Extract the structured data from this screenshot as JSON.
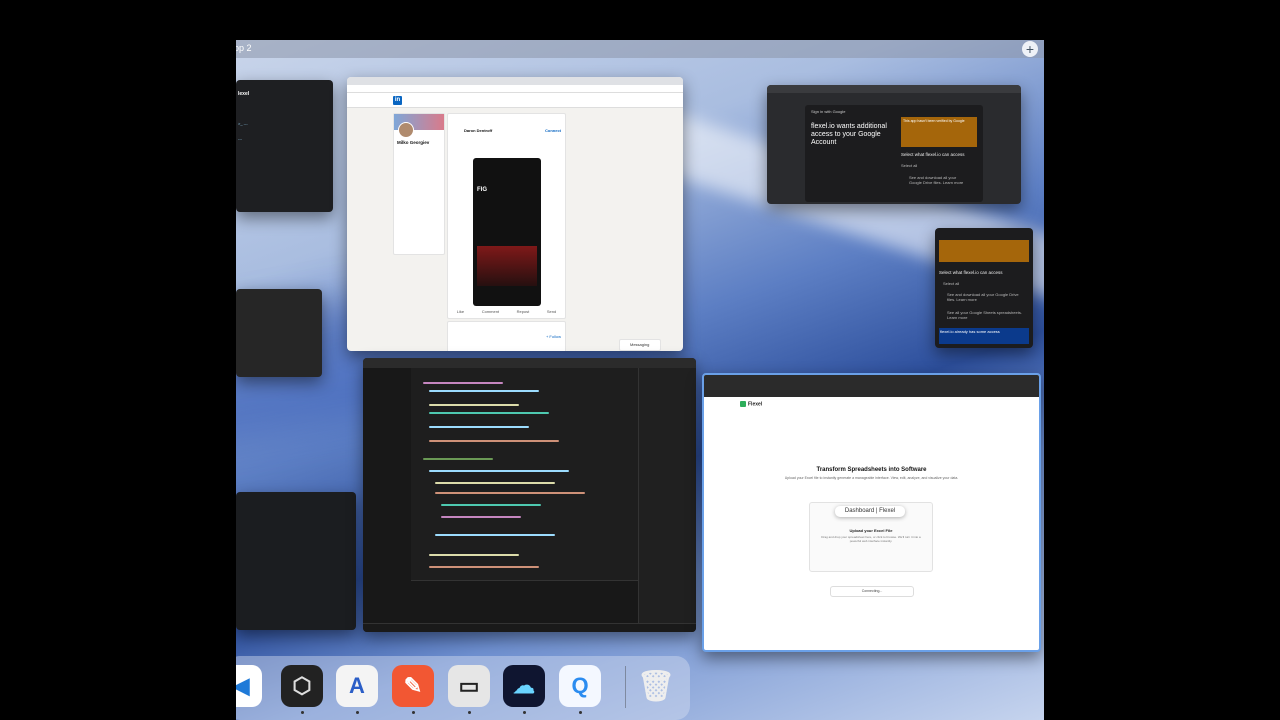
{
  "spaces_bar": {
    "label": "op 2",
    "add_icon": "plus-icon"
  },
  "linkedin": {
    "profile_name": "Milko Georgiev",
    "post_author": "Daron Dentroff",
    "post_action": "Connect",
    "ticker": "FIG",
    "actions": [
      "Like",
      "Comment",
      "Repost",
      "Send"
    ],
    "follow_label": "+ Follow",
    "messaging_label": "Messaging"
  },
  "google_auth": {
    "heading": "flexel.io wants additional access to your Google Account",
    "sign_in": "Sign in with Google",
    "question": "Select what flexel.io can access",
    "select_all": "Select all",
    "option_drive": "See and download all your Google Drive files. Learn more",
    "warning": "This app hasn't been verified by Google"
  },
  "google_auth_small": {
    "question": "Select what flexel.io can access",
    "select_all": "Select all",
    "option_drive": "See and download all your Google Drive files. Learn more",
    "option_sheets": "See all your Google Sheets spreadsheets. Learn more",
    "notice": "flexel.io already has some access"
  },
  "flexel": {
    "brand": "Flexel",
    "hero_title": "Transform Spreadsheets into Software",
    "hero_sub": "Upload your Excel file to instantly generate a manageable interface. View, edit, analyze, and visualize your data.",
    "upload_title": "Upload your Excel File",
    "upload_hint": "Drag and drop your spreadsheet here, or click to browse. We'll turn it into a powerful web interface instantly.",
    "tooltip": "Dashboard | Flexel",
    "connecting": "Connecting..."
  },
  "colors": {
    "accent": "#0a66c2",
    "flexel_green": "#2eae5b",
    "warning": "#a5660b"
  }
}
